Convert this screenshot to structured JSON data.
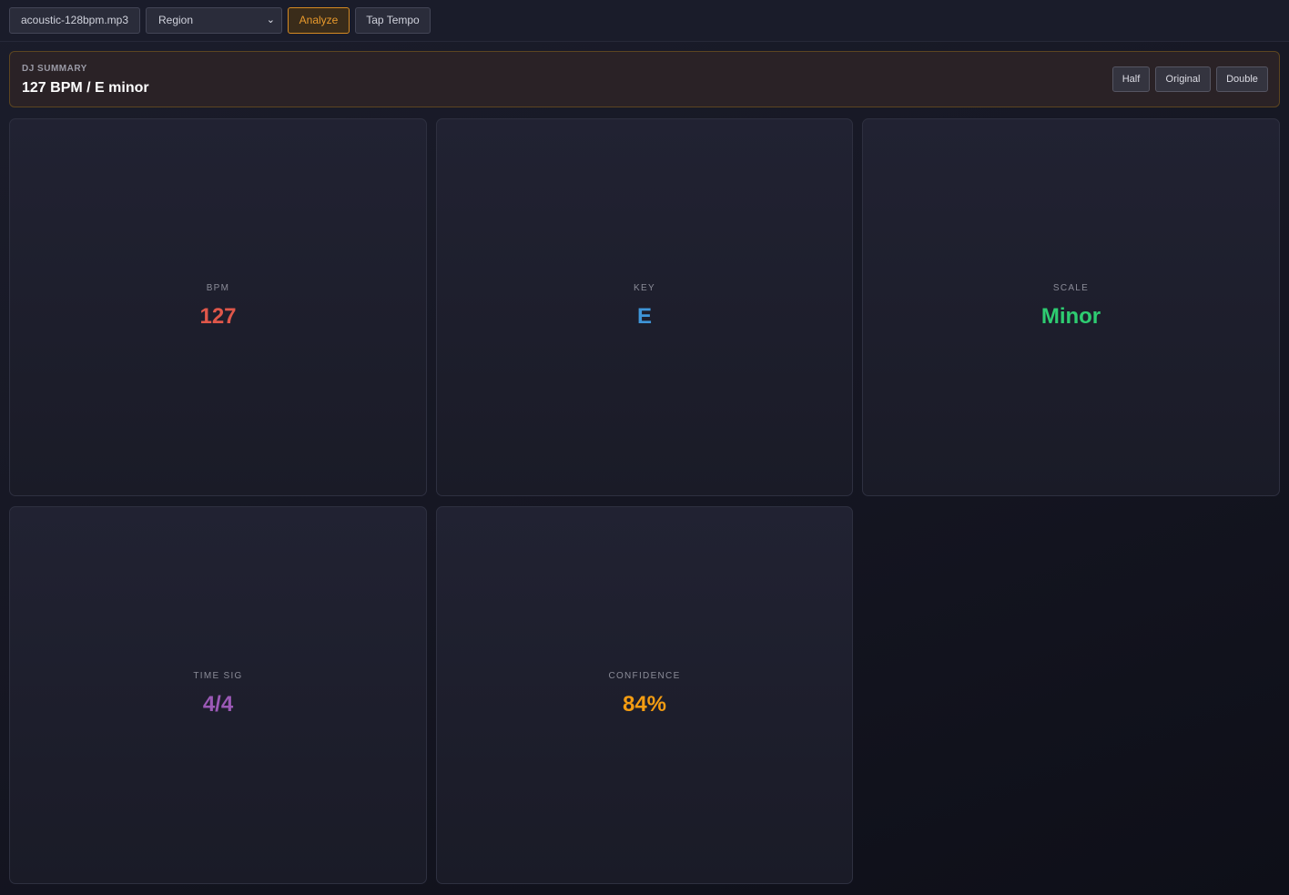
{
  "toolbar": {
    "file_label": "acoustic-128bpm.mp3",
    "region_selected": "Region",
    "analyze_label": "Analyze",
    "tap_tempo_label": "Tap Tempo"
  },
  "summary": {
    "label": "DJ SUMMARY",
    "value": "127 BPM / E minor",
    "buttons": {
      "half": "Half",
      "original": "Original",
      "double": "Double"
    }
  },
  "cards": [
    {
      "label": "BPM",
      "value": "127",
      "color": "#e0574a"
    },
    {
      "label": "KEY",
      "value": "E",
      "color": "#3f95d8"
    },
    {
      "label": "SCALE",
      "value": "Minor",
      "color": "#2ecc71"
    },
    {
      "label": "TIME SIG",
      "value": "4/4",
      "color": "#9b59b6"
    },
    {
      "label": "CONFIDENCE",
      "value": "84%",
      "color": "#f39c12"
    }
  ]
}
